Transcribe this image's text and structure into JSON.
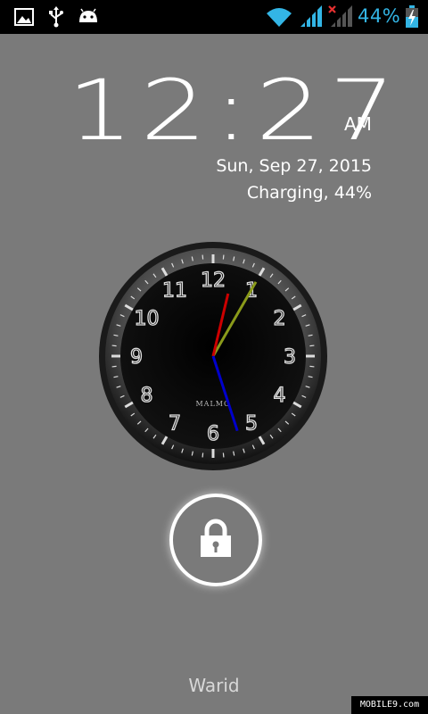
{
  "status_bar": {
    "icons_left": [
      "gallery-icon",
      "usb-icon",
      "android-debug-icon"
    ],
    "icons_right": [
      "wifi-icon",
      "signal-icon",
      "signal-no-service-icon",
      "battery-charging-icon"
    ],
    "battery_percent": "44%",
    "accent_color": "#33b5e5"
  },
  "lockscreen": {
    "time": "12:27",
    "ampm": "AM",
    "date": "Sun, Sep 27, 2015",
    "charging": "Charging, 44%",
    "carrier": "Warid"
  },
  "analog_clock": {
    "numbers": [
      "12",
      "1",
      "2",
      "3",
      "4",
      "5",
      "6",
      "7",
      "8",
      "9",
      "10",
      "11"
    ],
    "brand": "MALMO",
    "hour": 12,
    "minute": 27,
    "second": 5,
    "hand_colors": {
      "hour": "#cc0000",
      "minute": "#0000cc",
      "second": "#8a9a1a"
    }
  },
  "watermark": "MOBILE9.com"
}
